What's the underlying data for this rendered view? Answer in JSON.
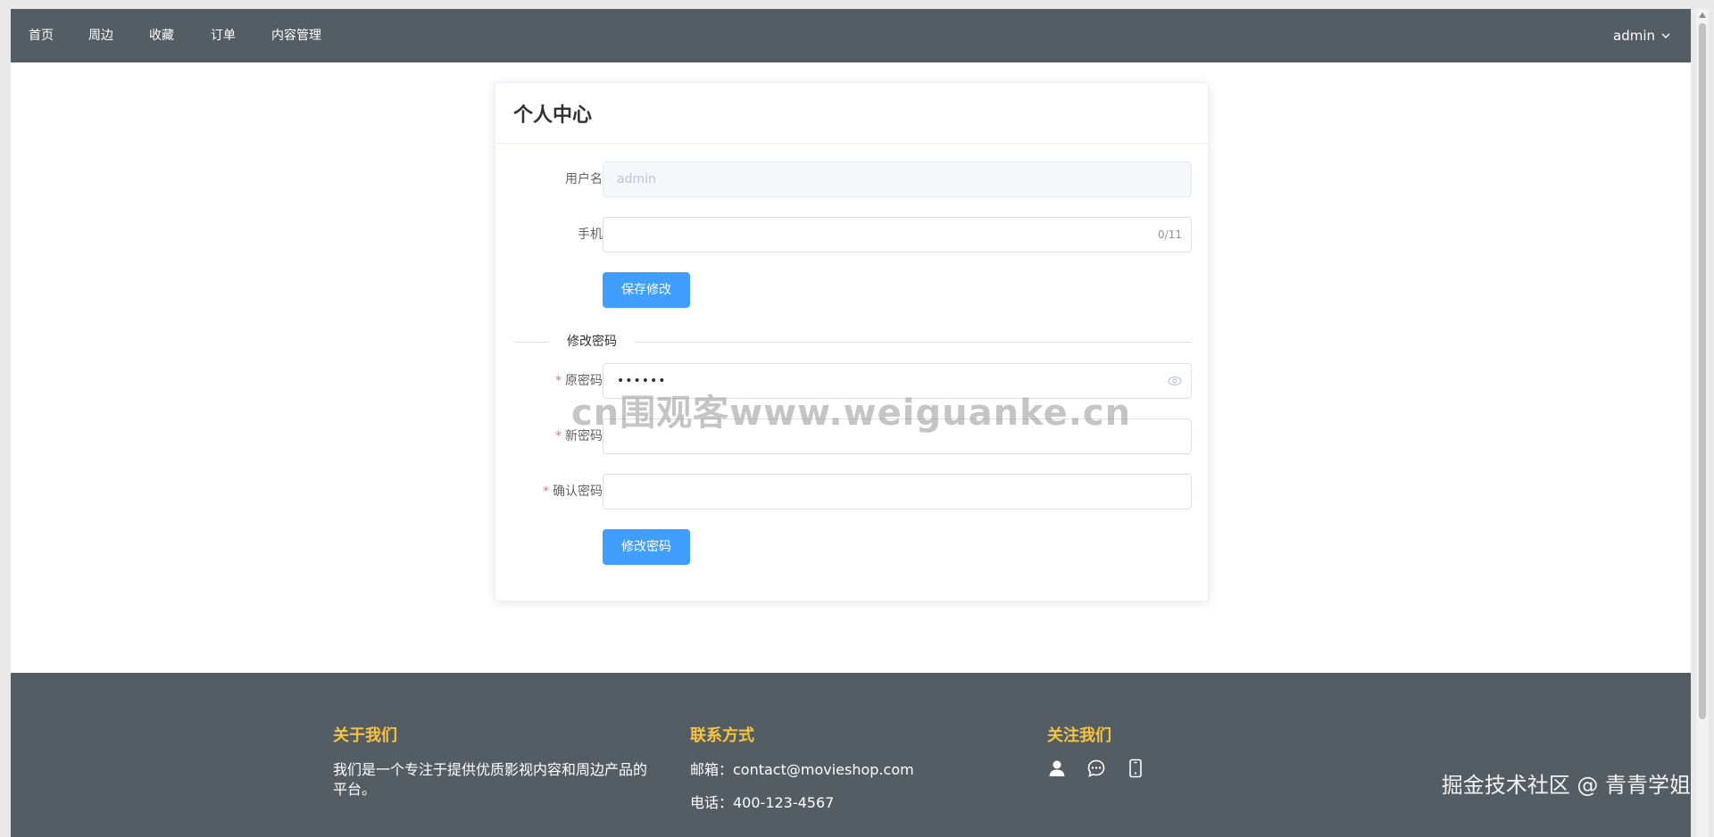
{
  "nav": {
    "items": [
      {
        "label": "首页"
      },
      {
        "label": "周边"
      },
      {
        "label": "收藏"
      },
      {
        "label": "订单"
      },
      {
        "label": "内容管理"
      }
    ],
    "user": "admin"
  },
  "card": {
    "title": "个人中心",
    "username_label": "用户名",
    "username_value": "admin",
    "phone_label": "手机",
    "phone_counter": "0/11",
    "save_button": "保存修改",
    "divider_text": "修改密码",
    "old_password_label": "原密码",
    "old_password_value": "••••••",
    "new_password_label": "新密码",
    "confirm_password_label": "确认密码",
    "change_password_button": "修改密码",
    "required_mark": "*"
  },
  "watermark": "cn围观客www.weiguanke.cn",
  "footer": {
    "about": {
      "title": "关于我们",
      "text": "我们是一个专注于提供优质影视内容和周边产品的平台。"
    },
    "contact": {
      "title": "联系方式",
      "email": "邮箱：contact@movieshop.com",
      "phone": "电话：400-123-4567"
    },
    "follow": {
      "title": "关注我们",
      "icons": [
        "user-icon",
        "chat-icon",
        "mobile-icon"
      ]
    },
    "credit": "掘金技术社区 @ 青青学姐"
  },
  "colors": {
    "nav_bg": "#545c64",
    "primary": "#409eff",
    "footer_title": "#f5c542",
    "required": "#f56c6c"
  }
}
